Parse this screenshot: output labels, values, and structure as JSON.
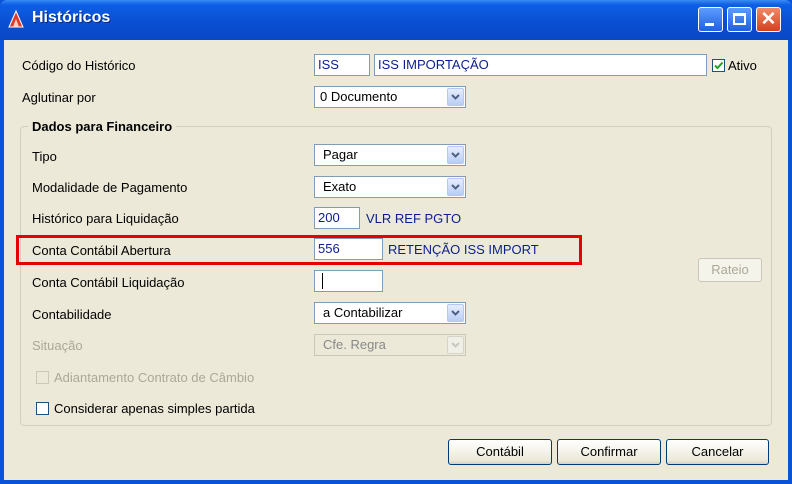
{
  "window": {
    "title": "Históricos",
    "minimize_icon": "minimize-icon",
    "maximize_icon": "maximize-icon",
    "close_icon": "close-icon"
  },
  "header": {
    "codigo_label": "Código do Histórico",
    "codigo_value": "ISS",
    "descricao_value": "ISS IMPORTAÇÃO",
    "ativo_label": "Ativo",
    "ativo_checked": true,
    "aglutinar_label": "Aglutinar por",
    "aglutinar_value": "0 Documento"
  },
  "financeiro": {
    "group_title": "Dados para Financeiro",
    "tipo_label": "Tipo",
    "tipo_value": "Pagar",
    "modalidade_label": "Modalidade de Pagamento",
    "modalidade_value": "Exato",
    "historico_liq_label": "Histórico para Liquidação",
    "historico_liq_code": "200",
    "historico_liq_desc": "VLR REF PGTO",
    "conta_abertura_label": "Conta Contábil Abertura",
    "conta_abertura_code": "556",
    "conta_abertura_desc": "RETENÇÃO ISS IMPORT",
    "conta_liq_label": "Conta Contábil Liquidação",
    "conta_liq_value": "",
    "contabilidade_label": "Contabilidade",
    "contabilidade_value": "a Contabilizar",
    "situacao_label": "Situação",
    "situacao_value": "Cfe. Regra",
    "adiantamento_label": "Adiantamento Contrato de Câmbio",
    "considerar_label": "Considerar apenas simples partida",
    "rateio_label": "Rateio"
  },
  "buttons": {
    "contabil": "Contábil",
    "confirmar": "Confirmar",
    "cancelar": "Cancelar"
  },
  "colors": {
    "highlight": "#e60000",
    "titlebar": "#0a4fd2",
    "face": "#ece9d8",
    "field_text": "#0a1f8f"
  }
}
